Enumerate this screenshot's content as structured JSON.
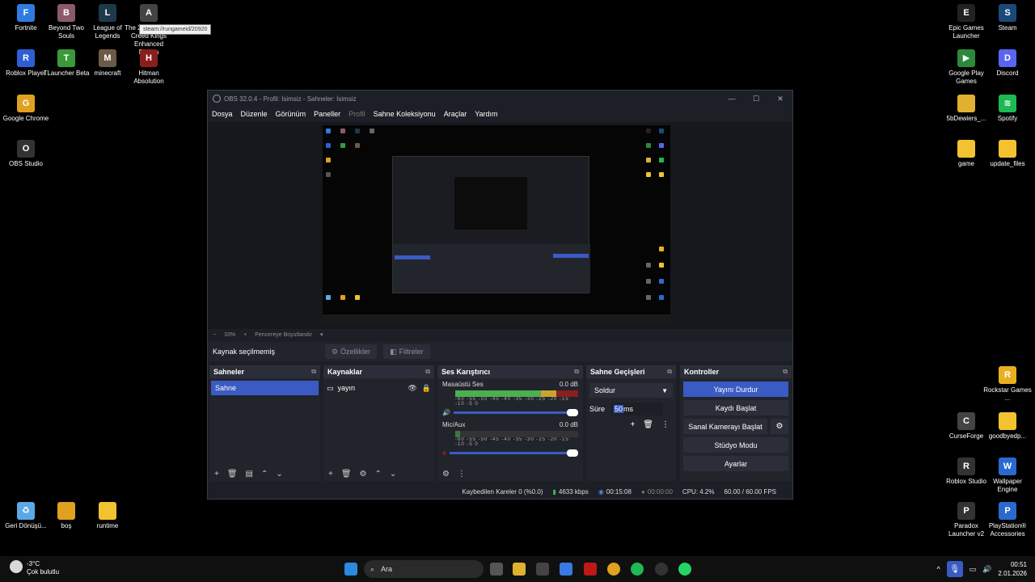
{
  "desktop_left": [
    {
      "label": "Fortnite",
      "icon": "fortnite-icon",
      "color": "#2f7be0",
      "glyph": "F"
    },
    {
      "label": "Beyond Two Souls",
      "icon": "beyond-two-souls-icon",
      "color": "#8b5a6b",
      "glyph": "B"
    },
    {
      "label": "League of Legends",
      "icon": "league-of-legends-icon",
      "color": "#1e3a4a",
      "glyph": "L"
    },
    {
      "label": "The 2 Assassin's Creed Kings Enhanced Edition",
      "icon": "game-icon",
      "color": "#444",
      "glyph": "A"
    },
    {
      "label": "Roblox Player",
      "icon": "roblox-icon",
      "color": "#2c5fd6",
      "glyph": "R"
    },
    {
      "label": "TLauncher Beta",
      "icon": "tlauncher-icon",
      "color": "#3a9a3a",
      "glyph": "T"
    },
    {
      "label": "minecraft",
      "icon": "minecraft-icon",
      "color": "#6b5a45",
      "glyph": "M"
    },
    {
      "label": "Hitman Absolution",
      "icon": "hitman-icon",
      "color": "#8a1e1e",
      "glyph": "H"
    },
    {
      "label": "Google Chrome",
      "icon": "chrome-icon",
      "color": "#e0a020",
      "glyph": "G"
    },
    {
      "label": "OBS Studio",
      "icon": "obs-icon",
      "color": "#333",
      "glyph": "O"
    },
    {
      "label": "Geri Dönüşü...",
      "icon": "recycle-bin-icon",
      "color": "#5aa9e6",
      "glyph": "♻"
    },
    {
      "label": "boş",
      "icon": "folder-icon",
      "color": "#e0a020",
      "glyph": ""
    },
    {
      "label": "runtime",
      "icon": "folder-icon",
      "color": "#f2c230",
      "glyph": ""
    }
  ],
  "desktop_right": [
    {
      "label": "Epic Games Launcher",
      "icon": "epic-games-icon",
      "color": "#222",
      "glyph": "E"
    },
    {
      "label": "Steam",
      "icon": "steam-icon",
      "color": "#1b4a7a",
      "glyph": "S"
    },
    {
      "label": "Google Play Games",
      "icon": "google-play-games-icon",
      "color": "#2a8a3a",
      "glyph": "▶"
    },
    {
      "label": "Discord",
      "icon": "discord-icon",
      "color": "#5865f2",
      "glyph": "D"
    },
    {
      "label": "5bDewiers_...",
      "icon": "folder-icon",
      "color": "#e0b030",
      "glyph": ""
    },
    {
      "label": "Spotify",
      "icon": "spotify-icon",
      "color": "#1db954",
      "glyph": "≋"
    },
    {
      "label": "game",
      "icon": "folder-icon",
      "color": "#f2c230",
      "glyph": ""
    },
    {
      "label": "update_files",
      "icon": "folder-icon",
      "color": "#f2c230",
      "glyph": ""
    },
    {
      "label": "Rockstar Games ...",
      "icon": "rockstar-icon",
      "color": "#e8b020",
      "glyph": "R"
    },
    {
      "label": "CurseForge",
      "icon": "curseforge-icon",
      "color": "#444",
      "glyph": "C"
    },
    {
      "label": "goodbyedp...",
      "icon": "folder-icon",
      "color": "#f2c230",
      "glyph": ""
    },
    {
      "label": "Roblox Studio",
      "icon": "roblox-studio-icon",
      "color": "#333",
      "glyph": "R"
    },
    {
      "label": "Wallpaper Engine",
      "icon": "wallpaper-engine-icon",
      "color": "#2a6ad0",
      "glyph": "W"
    },
    {
      "label": "Paradox Launcher v2",
      "icon": "paradox-icon",
      "color": "#333",
      "glyph": "P"
    },
    {
      "label": "PlayStation® Accessories",
      "icon": "playstation-icon",
      "color": "#2a6ad0",
      "glyph": "P"
    }
  ],
  "tooltip": "steam://rungameid/20920",
  "obs": {
    "title": "OBS 32.0.4 - Profil: İsimsiz - Sahneler: İsimsiz",
    "menu": [
      "Dosya",
      "Düzenle",
      "Görünüm",
      "Paneller",
      "Profil",
      "Sahne Koleksiyonu",
      "Araçlar",
      "Yardım"
    ],
    "zoom": "33%",
    "fit": "Pencereye Boyutlandır",
    "no_source": "Kaynak seçilmemiş",
    "properties": "Özellikler",
    "filters": "Filtreler",
    "scenes_title": "Sahneler",
    "scene": "Sahne",
    "sources_title": "Kaynaklar",
    "source": "yayın",
    "mixer_title": "Ses Karıştırıcı",
    "ch1_name": "Masaüstü Ses",
    "ch1_db": "0.0 dB",
    "ch2_name": "Mic/Aux",
    "ch2_db": "0.0 dB",
    "scale": "-60 -55 -50 -45 -40 -35 -30 -25 -20 -15 -10 -5 0",
    "trans_title": "Sahne Geçişleri",
    "transition": "Soldur",
    "duration_label": "Süre",
    "duration_value": "50",
    "duration_unit": " ms",
    "controls_title": "Kontroller",
    "stop_stream": "Yayını Durdur",
    "start_record": "Kaydı Başlat",
    "virtual_cam": "Sanal Kamerayı Başlat",
    "studio_mode": "Stüdyo Modu",
    "settings": "Ayarlar",
    "dropped": "Kaybedilen Kareler 0 (%0.0)",
    "bitrate": "4633 kbps",
    "stream_time": "00:15:08",
    "rec_time": "00:00:00",
    "cpu": "CPU: 4.2%",
    "fps": "60.00 / 60.00 FPS"
  },
  "weather": {
    "temp": "-3°C",
    "desc": "Çok bulutlu"
  },
  "search_placeholder": "Ara",
  "clock": {
    "time": "00:51",
    "date": "2.01.2026"
  }
}
